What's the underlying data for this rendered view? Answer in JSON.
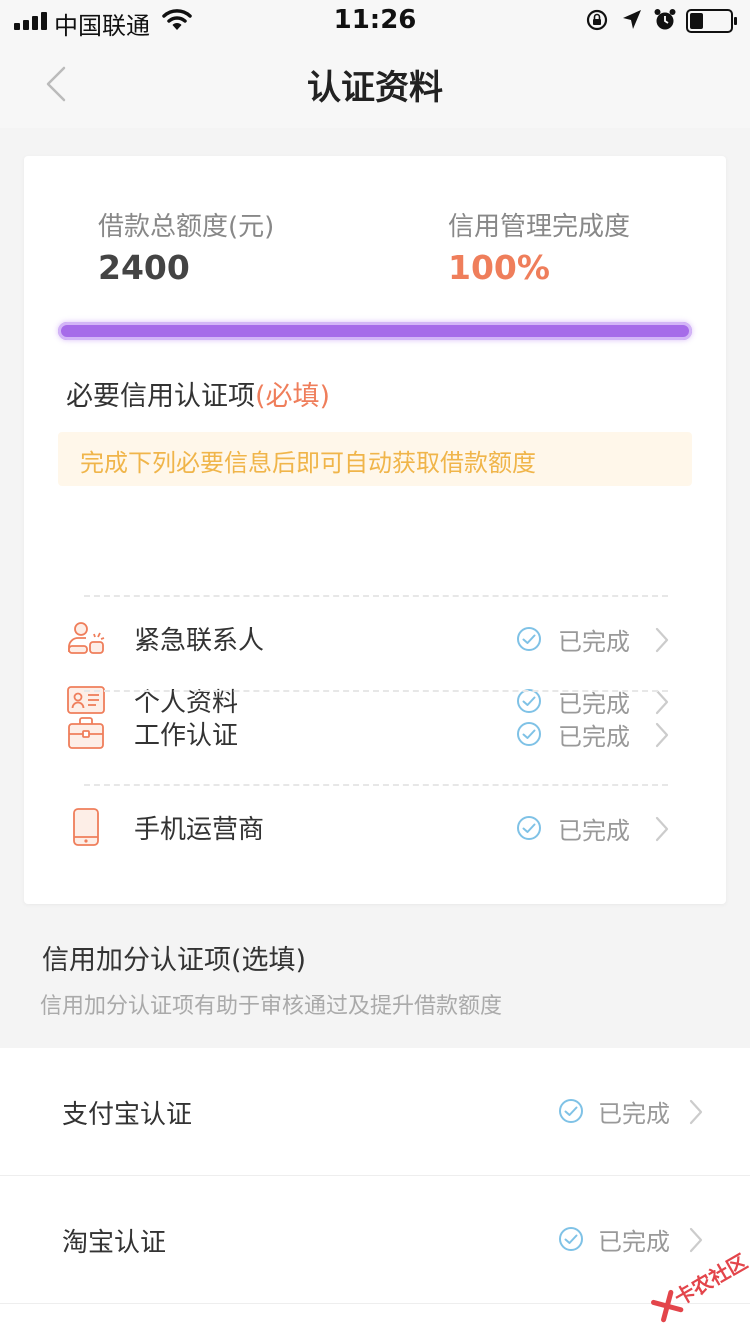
{
  "status_bar": {
    "carrier": "中国联通",
    "time": "11:26"
  },
  "nav": {
    "title": "认证资料"
  },
  "summary": {
    "limit_label": "借款总额度(元)",
    "limit_value": "2400",
    "progress_label": "信用管理完成度",
    "progress_value": "100%",
    "progress_fraction": 1.0
  },
  "required": {
    "title": "必要信用认证项",
    "required_tag": "(必填)",
    "notice": "完成下列必要信息后即可自动获取借款额度",
    "items": [
      {
        "label": "个人资料",
        "status": "已完成",
        "icon": "id-card-icon"
      },
      {
        "label": "紧急联系人",
        "status": "已完成",
        "icon": "contact-icon"
      },
      {
        "label": "工作认证",
        "status": "已完成",
        "icon": "briefcase-icon"
      },
      {
        "label": "手机运营商",
        "status": "已完成",
        "icon": "phone-icon"
      }
    ]
  },
  "bonus": {
    "title": "信用加分认证项(选填)",
    "subtitle": "信用加分认证项有助于审核通过及提升借款额度",
    "items": [
      {
        "label": "支付宝认证",
        "status": "已完成"
      },
      {
        "label": "淘宝认证",
        "status": "已完成"
      }
    ]
  },
  "watermark": {
    "text": "卡农社区"
  },
  "colors": {
    "accent_orange": "#ef7e5b",
    "progress_purple": "#a66be9",
    "check_blue": "#7fc2e6",
    "notice_text": "#f0b54a"
  }
}
